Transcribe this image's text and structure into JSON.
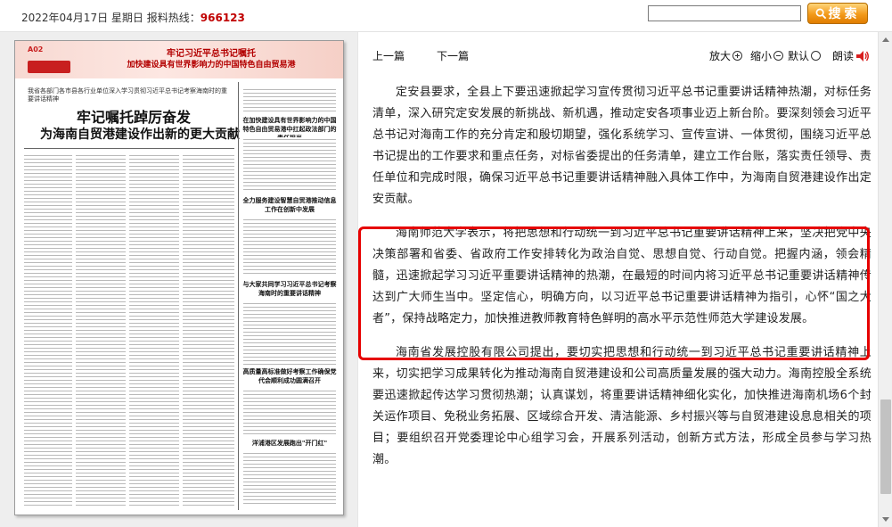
{
  "topbar": {
    "date": "2022年04月17日",
    "weekday": "星期日",
    "hotline_label": "报料热线：",
    "hotline": "966123",
    "search_value": "",
    "search_button": "搜索"
  },
  "paper": {
    "page_no": "A02",
    "banner_line1": "牢记习近平总书记嘱托",
    "banner_line2": "加快建设具有世界影响力的中国特色自由贸易港",
    "subtitle": "我省各部门各市县各行业单位深入学习贯彻习近平总书记考察海南时的重要讲话精神",
    "headline_line1": "牢记嘱托踔厉奋发",
    "headline_line2": "为海南自贸港建设作出新的更大贡献",
    "side_heads": [
      "在加快建设具有世界影响力的中国特色自由贸易港中扛起政法部门的责任担当",
      "全力服务建设智慧自贸港推动信息工作在创新中发展",
      "与大家共同学习习近平总书记考察海南时的重要讲话精神",
      "高质量高标准做好考察工作确保党代会顺利成功圆满召开",
      "洋浦港区发展跑出\"开门红\""
    ]
  },
  "toolbar": {
    "prev": "上一篇",
    "next": "下一篇",
    "zoom_in": "放大",
    "zoom_out": "缩小",
    "default": "默认",
    "read_aloud": "朗读"
  },
  "article": {
    "paragraphs": [
      "定安县要求，全县上下要迅速掀起学习宣传贯彻习近平总书记重要讲话精神热潮，对标任务清单，深入研究定安发展的新挑战、新机遇，推动定安各项事业迈上新台阶。要深刻领会习近平总书记对海南工作的充分肯定和殷切期望，强化系统学习、宣传宣讲、一体贯彻，围绕习近平总书记提出的工作要求和重点任务，对标省委提出的任务清单，建立工作台账，落实责任领导、责任单位和完成时限，确保习近平总书记重要讲话精神融入具体工作中，为海南自贸港建设作出定安贡献。",
      "海南师范大学表示，将把思想和行动统一到习近平总书记重要讲话精神上来，坚决把党中央决策部署和省委、省政府工作安排转化为政治自觉、思想自觉、行动自觉。把握内涵，领会精髓，迅速掀起学习习近平重要讲话精神的热潮，在最短的时间内将习近平总书记重要讲话精神传达到广大师生当中。坚定信心，明确方向，以习近平总书记重要讲话精神为指引，心怀“国之大者”，保持战略定力，加快推进教师教育特色鲜明的高水平示范性师范大学建设发展。",
      "海南省发展控股有限公司提出，要切实把思想和行动统一到习近平总书记重要讲话精神上来，切实把学习成果转化为推动海南自贸港建设和公司高质量发展的强大动力。海南控股全系统要迅速掀起传达学习贯彻热潮；认真谋划，将重要讲话精神细化实化，加快推进海南机场6个封关运作项目、免税业务拓展、区域综合开发、清洁能源、乡村振兴等与自贸港建设息息相关的项目；要组织召开党委理论中心组学习会，开展系列活动，创新方式方法，形成全员参与学习热潮。"
    ]
  },
  "colors": {
    "hotline": "#c00000",
    "highlight_border": "#e60000",
    "search_button": "#f39a1a"
  }
}
